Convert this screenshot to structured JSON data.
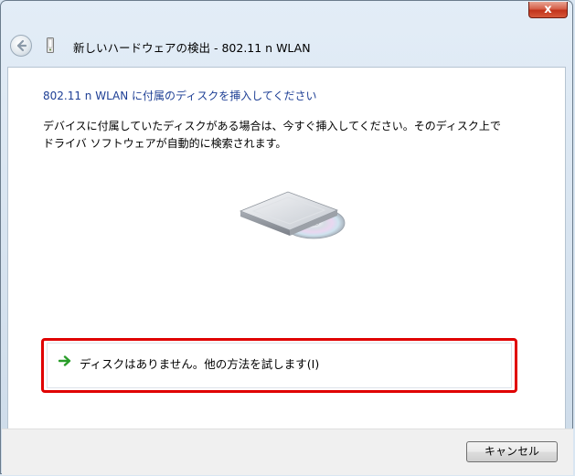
{
  "window": {
    "close_label": "x"
  },
  "nav": {
    "title": "新しいハードウェアの検出 - 802.11 n WLAN"
  },
  "content": {
    "heading": "802.11 n WLAN に付属のディスクを挿入してください",
    "description_line1": "デバイスに付属していたディスクがある場合は、今すぐ挿入してください。そのディスク上で",
    "description_line2": "ドライバ ソフトウェアが自動的に検索されます。",
    "option_label": "ディスクはありません。他の方法を試します(I)"
  },
  "footer": {
    "cancel_label": "キャンセル"
  },
  "colors": {
    "heading": "#1e3f95",
    "highlight": "#e00000",
    "arrow": "#2a9d2a"
  }
}
